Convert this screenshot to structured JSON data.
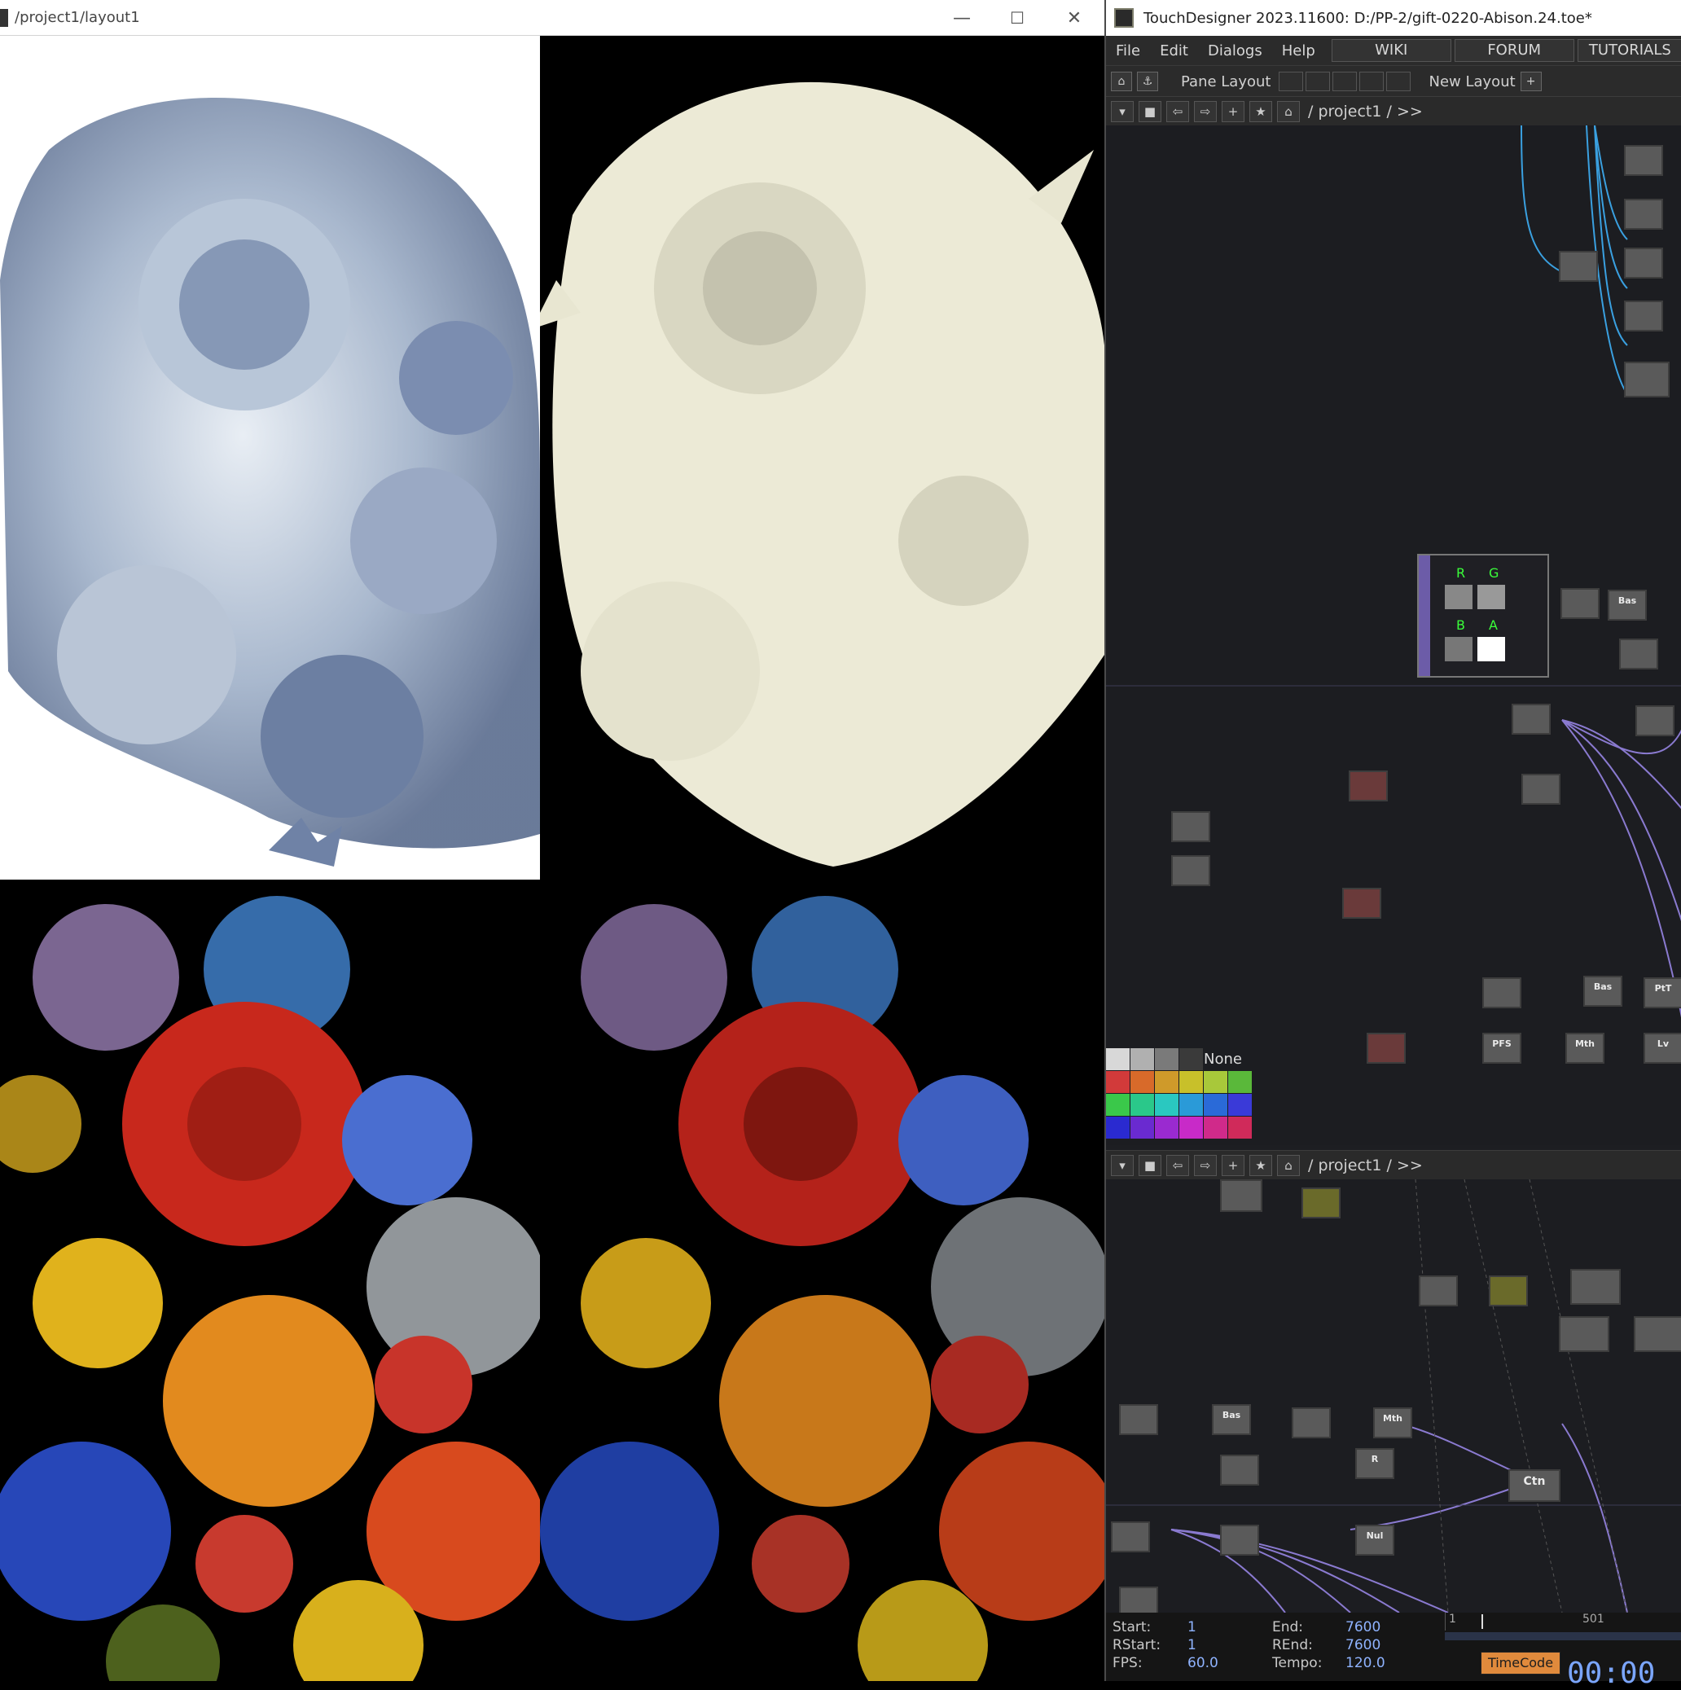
{
  "viewer": {
    "title": "/project1/layout1",
    "controls": {
      "minimize": "—",
      "maximize": "☐",
      "close": "✕"
    }
  },
  "td": {
    "title": "TouchDesigner 2023.11600: D:/PP-2/gift-0220-Abison.24.toe*",
    "menu": [
      "File",
      "Edit",
      "Dialogs",
      "Help"
    ],
    "nav": [
      "WIKI",
      "FORUM",
      "TUTORIALS"
    ],
    "toolbar": {
      "pane_layout": "Pane Layout",
      "new_layout": "New Layout",
      "add": "+"
    },
    "path_top": "/ project1 / >>",
    "path_bottom": "/ project1 / >>",
    "swatch_none": "None",
    "swatch_colors": [
      "#d8d8d8",
      "#b0b0b0",
      "#7a7a7a",
      "#3a3a3a",
      "#d23a3a",
      "#d86a2a",
      "#cf9a2a",
      "#c8c02a",
      "#a8c83a",
      "#5ab83a",
      "#3ac84a",
      "#2ac88a",
      "#2ac8c0",
      "#2a9ad8",
      "#2a6ad8",
      "#3a3ad8",
      "#2a2ad0",
      "#6a2ad0",
      "#9a2ad0",
      "#c82ac8",
      "#d02a8a",
      "#d02a5a"
    ],
    "ops_top": [
      {
        "label": "RGB",
        "color": "#6a6fb5"
      },
      {
        "label": "Bas",
        "color": "#5a5a5a"
      },
      {
        "label": "PFS",
        "color": "#5a5a5a"
      },
      {
        "label": "Mth",
        "color": "#5a5a5a"
      },
      {
        "label": "PtT",
        "color": "#5a5a5a"
      },
      {
        "label": "Lv",
        "color": "#5a5a5a"
      }
    ],
    "ops_bottom": [
      {
        "label": "Bas"
      },
      {
        "label": "Mth"
      },
      {
        "label": "Ctn"
      },
      {
        "label": "Nul"
      },
      {
        "label": "R"
      }
    ],
    "channel_labels": [
      "R",
      "G",
      "B",
      "A"
    ],
    "timebar": {
      "start_label": "Start:",
      "start": "1",
      "rstart_label": "RStart:",
      "rstart": "1",
      "fps_label": "FPS:",
      "fps": "60.0",
      "end_label": "End:",
      "end": "7600",
      "rend_label": "REnd:",
      "rend": "7600",
      "tempo_label": "Tempo:",
      "tempo": "120.0",
      "ruler_start": "1",
      "ruler_mid": "501",
      "timecode_btn": "TimeCode",
      "timecode": "00:00"
    }
  }
}
